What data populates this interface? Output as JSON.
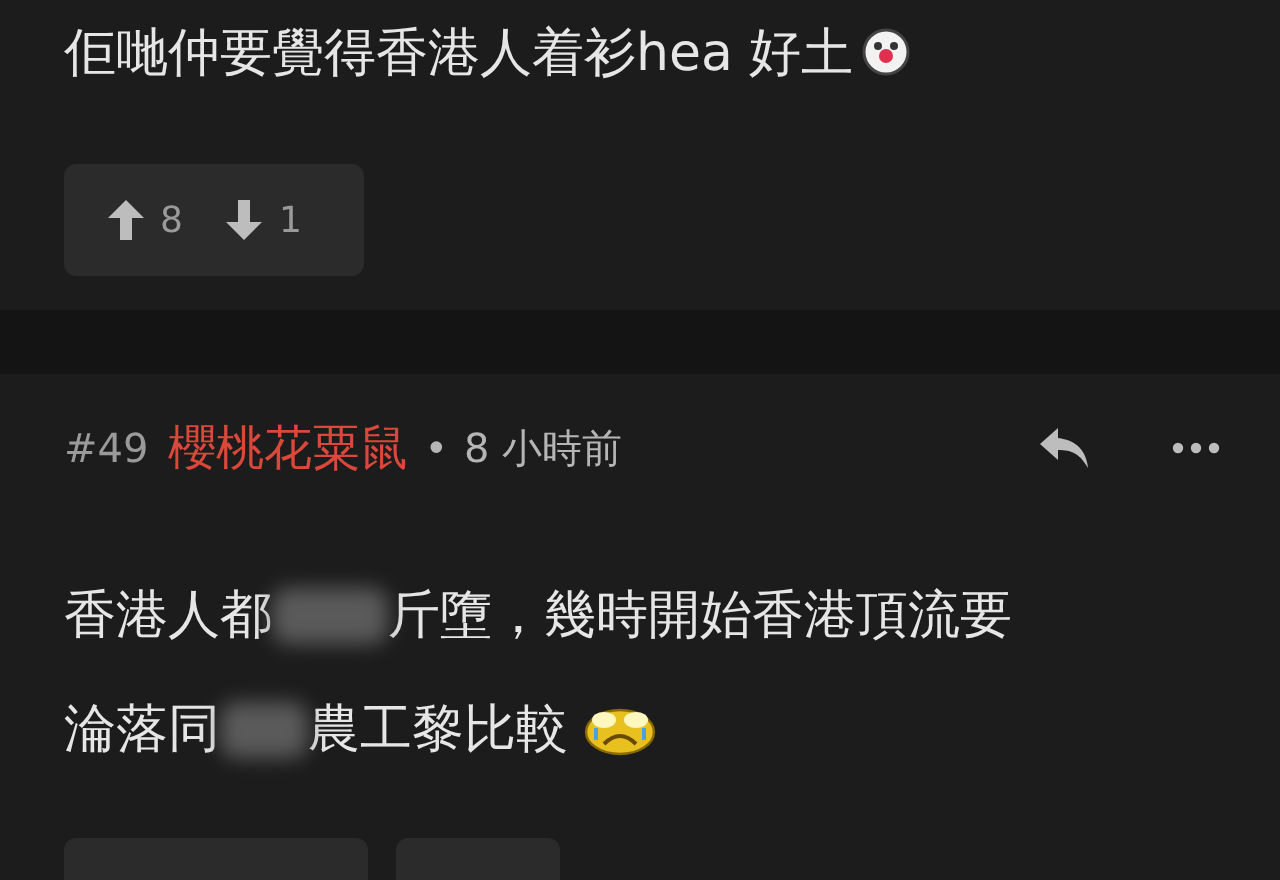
{
  "posts": [
    {
      "body_lines": [
        [
          {
            "kind": "text",
            "text": "佢哋仲要覺得香港人着衫hea 好土"
          },
          {
            "kind": "clown_emoji"
          }
        ]
      ],
      "votes": {
        "up": "8",
        "down": "1"
      }
    },
    {
      "number": "#49",
      "author": "櫻桃花粟鼠",
      "separator": "•",
      "time": "8 小時前",
      "body_lines": [
        [
          {
            "kind": "text",
            "text": "香港人都"
          },
          {
            "kind": "blur"
          },
          {
            "kind": "text",
            "text": "斤墮，幾時開始香港頂流要"
          }
        ],
        [
          {
            "kind": "text",
            "text": "淪落同"
          },
          {
            "kind": "blur"
          },
          {
            "kind": "text",
            "text": "農工黎比較"
          },
          {
            "kind": "crying_emoji"
          }
        ]
      ]
    }
  ]
}
